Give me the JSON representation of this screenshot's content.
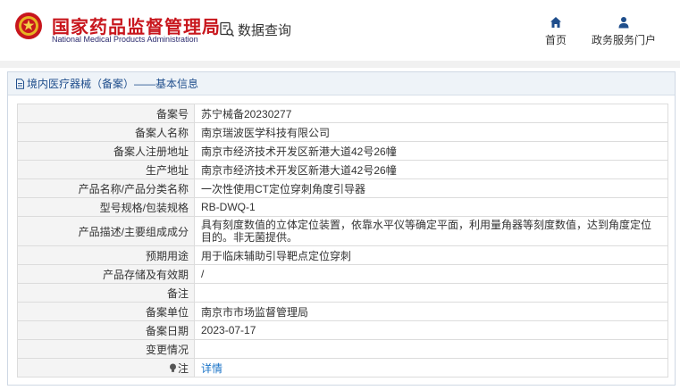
{
  "header": {
    "title": "国家药品监督管理局",
    "subtitle": "National Medical Products Administration",
    "query_label": "数据查询",
    "nav": [
      {
        "label": "首页",
        "icon": "home-icon"
      },
      {
        "label": "政务服务门户",
        "icon": "user-icon"
      }
    ]
  },
  "panel": {
    "title": "境内医疗器械（备案）——基本信息",
    "icon": "document-icon"
  },
  "fields": [
    {
      "key": "备案号",
      "value": "苏宁械备20230277"
    },
    {
      "key": "备案人名称",
      "value": "南京瑞波医学科技有限公司"
    },
    {
      "key": "备案人注册地址",
      "value": "南京市经济技术开发区新港大道42号26幢"
    },
    {
      "key": "生产地址",
      "value": "南京市经济技术开发区新港大道42号26幢"
    },
    {
      "key": "产品名称/产品分类名称",
      "value": "一次性使用CT定位穿刺角度引导器"
    },
    {
      "key": "型号规格/包装规格",
      "value": "RB-DWQ-1"
    },
    {
      "key": "产品描述/主要组成成分",
      "value": "具有刻度数值的立体定位装置，依靠水平仪等确定平面，利用量角器等刻度数值，达到角度定位目的。非无菌提供。"
    },
    {
      "key": "预期用途",
      "value": "用于临床辅助引导靶点定位穿刺"
    },
    {
      "key": "产品存储及有效期",
      "value": "/"
    },
    {
      "key": "备注",
      "value": ""
    },
    {
      "key": "备案单位",
      "value": "南京市市场监督管理局"
    },
    {
      "key": "备案日期",
      "value": "2023-07-17"
    },
    {
      "key": "变更情况",
      "value": ""
    },
    {
      "key": "注",
      "value": "详情",
      "icon": "lightbulb-icon"
    }
  ],
  "colors": {
    "brand_red": "#c8161d",
    "nav_blue": "#1f4e8c",
    "link_blue": "#1a73c7"
  }
}
